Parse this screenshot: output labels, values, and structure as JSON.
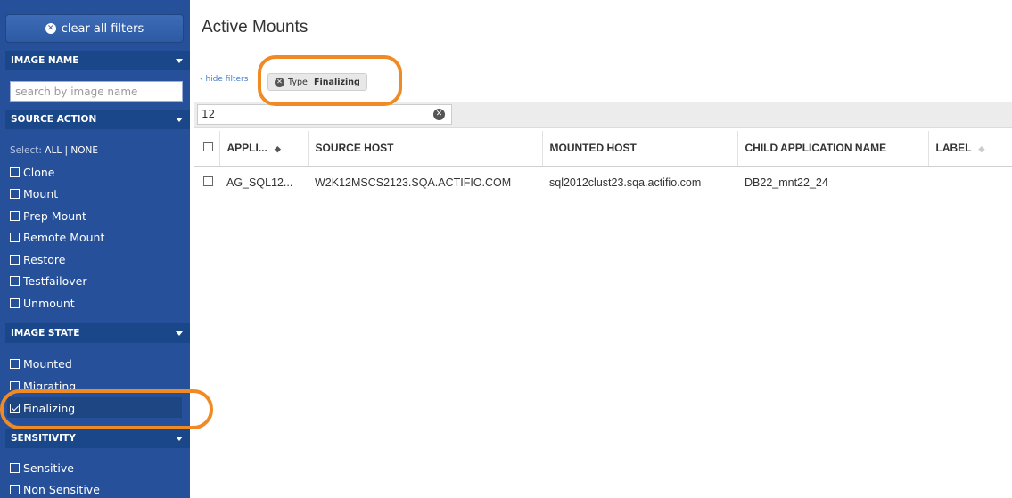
{
  "sidebar": {
    "clear_all_label": "clear all filters",
    "image_name": {
      "header": "IMAGE NAME",
      "search_placeholder": "search by image name"
    },
    "source_action": {
      "header": "SOURCE ACTION",
      "select_prefix": "Select:",
      "select_all": "ALL",
      "select_sep": "|",
      "select_none": "NONE",
      "options": [
        {
          "label": "Clone",
          "checked": false
        },
        {
          "label": "Mount",
          "checked": false
        },
        {
          "label": "Prep Mount",
          "checked": false
        },
        {
          "label": "Remote Mount",
          "checked": false
        },
        {
          "label": "Restore",
          "checked": false
        },
        {
          "label": "Testfailover",
          "checked": false
        },
        {
          "label": "Unmount",
          "checked": false
        }
      ]
    },
    "image_state": {
      "header": "IMAGE STATE",
      "options": [
        {
          "label": "Mounted",
          "checked": false
        },
        {
          "label": "Migrating",
          "checked": false
        },
        {
          "label": "Finalizing",
          "checked": true
        }
      ]
    },
    "sensitivity": {
      "header": "SENSITIVITY",
      "options": [
        {
          "label": "Sensitive",
          "checked": false
        },
        {
          "label": "Non Sensitive",
          "checked": false
        }
      ]
    }
  },
  "main": {
    "title": "Active Mounts",
    "hide_filters_label": "‹ hide filters",
    "active_filter": {
      "key": "Type:",
      "value": "Finalizing"
    },
    "count_value": "12",
    "table": {
      "columns": [
        "APPLI...",
        "SOURCE HOST",
        "MOUNTED HOST",
        "CHILD APPLICATION NAME",
        "LABEL"
      ],
      "rows": [
        [
          "AG_SQL12...",
          "W2K12MSCS2123.SQA.ACTIFIO.COM",
          "sql2012clust23.sqa.actifio.com",
          "DB22_mnt22_24",
          ""
        ]
      ]
    }
  },
  "colors": {
    "sidebar_bg": "#26509a",
    "section_header_bg": "#1a4789",
    "highlight": "#f08a24",
    "link": "#4a7fc8"
  },
  "icons": {
    "clear": "x-circle-icon",
    "caret": "caret-down-icon",
    "sort": "sort-updown-icon"
  }
}
